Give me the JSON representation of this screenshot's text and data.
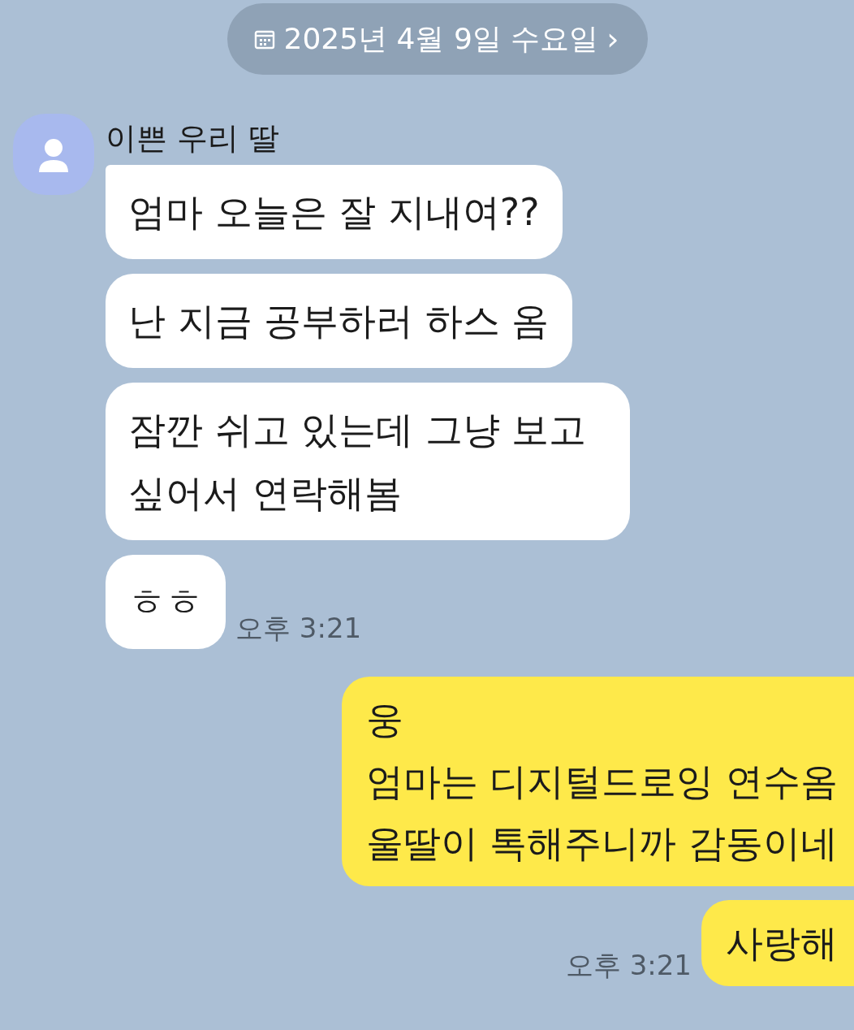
{
  "date_chip": {
    "text": "2025년 4월 9일 수요일",
    "chevron": "›"
  },
  "incoming": {
    "sender": "이쁜 우리 딸",
    "messages": [
      {
        "text": "엄마 오늘은 잘 지내여??"
      },
      {
        "text": "난 지금 공부하러 하스 옴"
      },
      {
        "text": "잠깐 쉬고 있는데 그냥 보고 싶어서 연락해봄"
      },
      {
        "text": "ㅎㅎ",
        "time": "오후 3:21"
      }
    ]
  },
  "outgoing": {
    "messages": [
      {
        "text": "웅\n엄마는 디지털드로잉 연수옴\n울딸이 톡해주니까 감동이네"
      },
      {
        "text": "사랑해",
        "time": "오후 3:21"
      }
    ]
  }
}
